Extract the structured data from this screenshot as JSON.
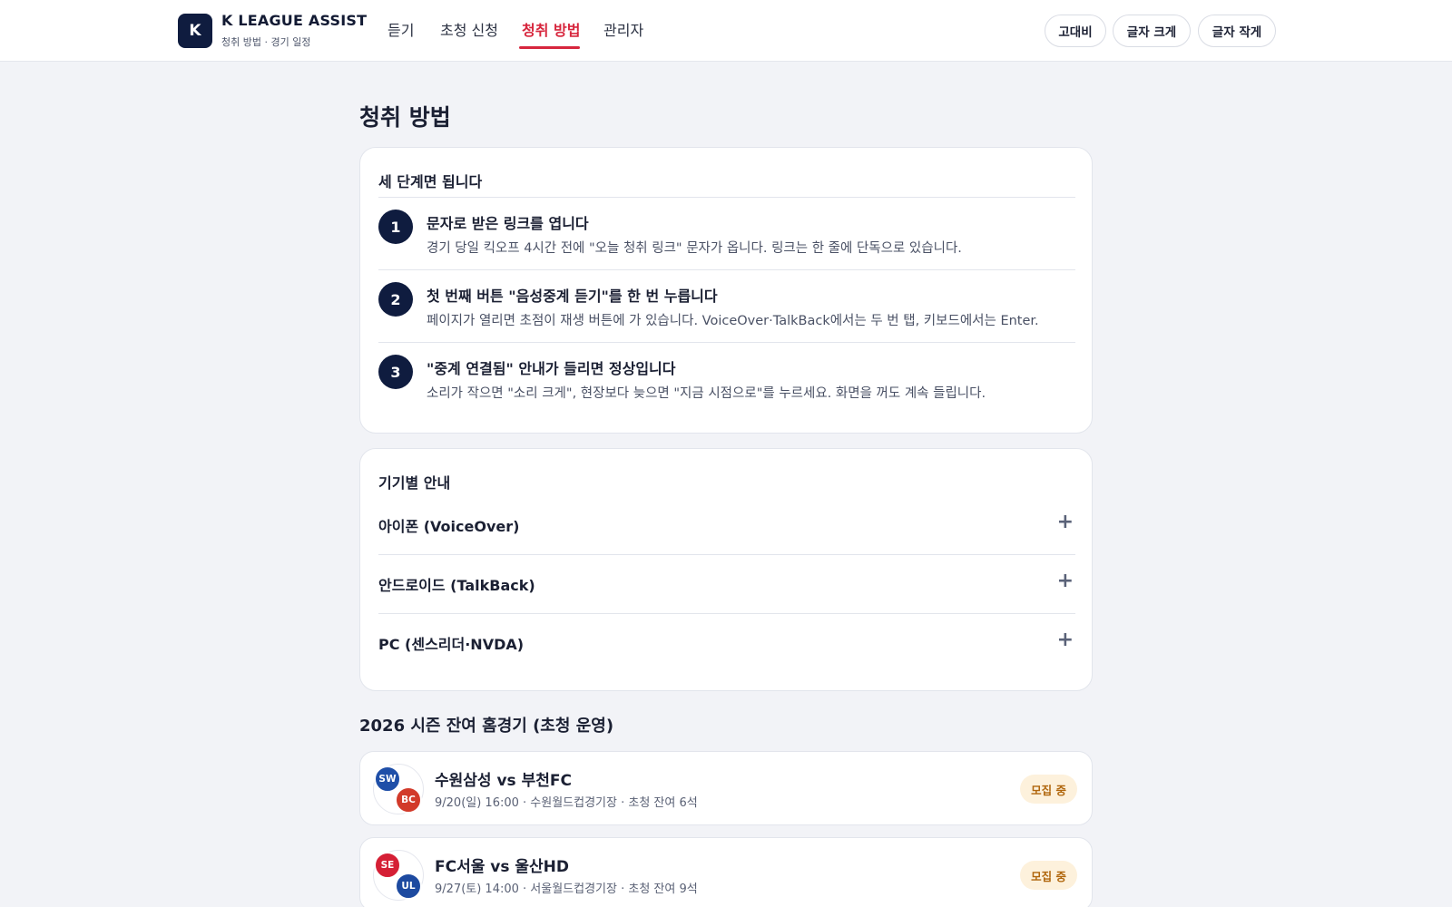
{
  "header": {
    "logo_letter": "K",
    "title": "K LEAGUE ASSIST",
    "subtitle": "청취 방법 · 경기 일정",
    "nav": [
      {
        "label": "듣기",
        "active": false
      },
      {
        "label": "초청 신청",
        "active": false
      },
      {
        "label": "청취 방법",
        "active": true
      },
      {
        "label": "관리자",
        "active": false
      }
    ],
    "controls": [
      "고대비",
      "글자 크게",
      "글자 작게"
    ],
    "accent_color": "#d7263d"
  },
  "main": {
    "page_title": "청취 방법",
    "steps_card": {
      "heading": "세 단계면 됩니다",
      "steps": [
        {
          "num": "1",
          "title": "문자로 받은 링크를 엽니다",
          "desc": "경기 당일 킥오프 4시간 전에 \"오늘 청취 링크\" 문자가 옵니다. 링크는 한 줄에 단독으로 있습니다."
        },
        {
          "num": "2",
          "title": "첫 번째 버튼 \"음성중계 듣기\"를 한 번 누릅니다",
          "desc": "페이지가 열리면 초점이 재생 버튼에 가 있습니다. VoiceOver·TalkBack에서는 두 번 탭, 키보드에서는 Enter."
        },
        {
          "num": "3",
          "title": "\"중계 연결됨\" 안내가 들리면 정상입니다",
          "desc": "소리가 작으면 \"소리 크게\", 현장보다 늦으면 \"지금 시점으로\"를 누르세요. 화면을 꺼도 계속 들립니다."
        }
      ]
    },
    "devices_card": {
      "heading": "기기별 안내",
      "items": [
        "아이폰 (VoiceOver)",
        "안드로이드 (TalkBack)",
        "PC (센스리더·NVDA)"
      ],
      "expand_icon": "+"
    },
    "schedule": {
      "title": "2026 시즌 잔여 홈경기 (초청 운영)",
      "matches": [
        {
          "home_code": "SW",
          "away_code": "BC",
          "home_color": "#1f4fa8",
          "away_color": "#d23a2a",
          "title": "수원삼성 vs 부천FC",
          "meta": "9/20(일) 16:00 · 수원월드컵경기장 · 초청 잔여 6석",
          "status": "모집 중"
        },
        {
          "home_code": "SE",
          "away_code": "UL",
          "home_color": "#d51f35",
          "away_color": "#1d4aa0",
          "title": "FC서울 vs 울산HD",
          "meta": "9/27(토) 14:00 · 서울월드컵경기장 · 초청 잔여 9석",
          "status": "모집 중"
        }
      ]
    }
  }
}
